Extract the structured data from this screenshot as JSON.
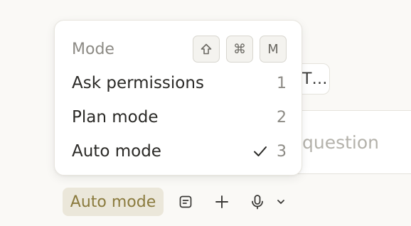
{
  "background": {
    "chip_text": "T…",
    "input_placeholder": "question"
  },
  "menu": {
    "title": "Mode",
    "shortcut_keys": [
      "⇧",
      "⌘",
      "M"
    ],
    "items": [
      {
        "label": "Ask permissions",
        "shortcut": "1",
        "selected": false
      },
      {
        "label": "Plan mode",
        "shortcut": "2",
        "selected": false
      },
      {
        "label": "Auto mode",
        "shortcut": "3",
        "selected": true
      }
    ]
  },
  "toolbar": {
    "mode_label": "Auto mode",
    "icons": [
      "note-icon",
      "plus-icon",
      "microphone-icon",
      "chevron-down-icon"
    ]
  },
  "colors": {
    "mode_chip_bg": "#ebe7da",
    "mode_chip_text": "#8a7a3d"
  }
}
